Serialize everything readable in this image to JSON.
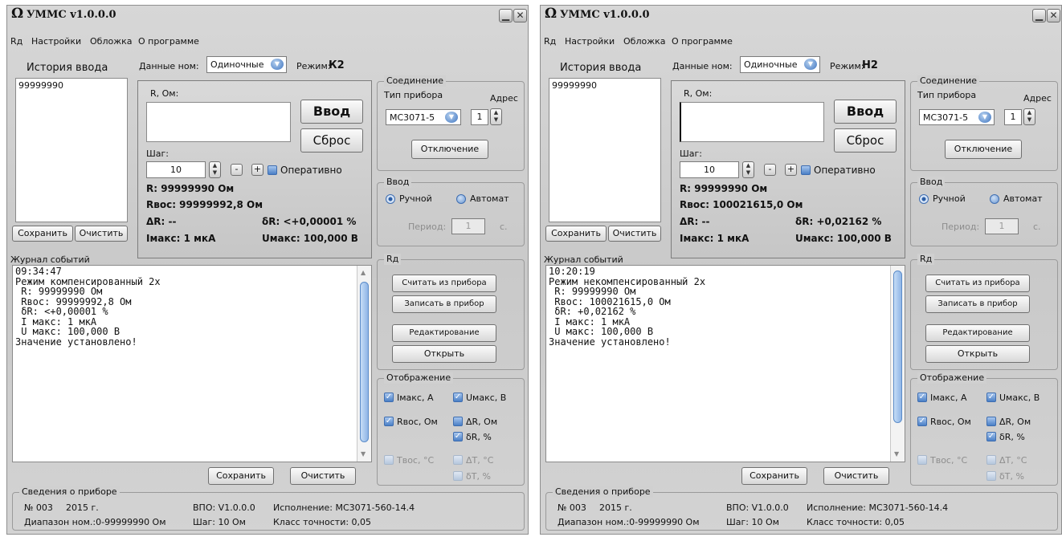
{
  "windows": [
    {
      "title": "УММС v1.0.0.0",
      "menu": [
        "Rд",
        "Настройки",
        "Обложка",
        "О программе"
      ],
      "history_label": "История ввода",
      "history_items": [
        "99999990"
      ],
      "save_label": "Сохранить",
      "clear_label": "Очистить",
      "data_nom_label": "Данные ном:",
      "data_nom_value": "Одиночные",
      "mode_label": "Режим:",
      "mode_value": "К2",
      "r_label": "R, Ом:",
      "r_input": "",
      "enter_label": "Ввод",
      "reset_label": "Сброс",
      "step_label": "Шаг:",
      "step_value": "10",
      "minus": "-",
      "plus": "+",
      "operative_label": "Оперативно",
      "r_line": "R: 99999990 Ом",
      "rvos_line": "Rвос: 99999992,8 Ом",
      "dR_line": "ΔR: --",
      "deltaR_line": "δR: <+0,00001 %",
      "imax_line": "Iмакс: 1 мкА",
      "umax_line": "Uмакс: 100,000 В",
      "connection": {
        "legend": "Соединение",
        "device_type_label": "Тип прибора",
        "address_label": "Адрес",
        "device_value": "МС3071-5",
        "address_value": "1",
        "disconnect_label": "Отключение"
      },
      "input_mode": {
        "legend": "Ввод",
        "manual": "Ручной",
        "auto": "Автомат",
        "period_label": "Период:",
        "period_value": "1",
        "unit": "с."
      },
      "log_label": "Журнал событий",
      "log_lines": [
        "09:34:47",
        "Режим компенсированный 2х",
        " R: 99999990 Ом",
        " Rвос: 99999992,8 Ом",
        " δR: <+0,00001 %",
        " I макс: 1 мкА",
        " U макс: 100,000 В",
        "Значение установлено!"
      ],
      "log_save": "Сохранить",
      "log_clear": "Очистить",
      "rd_group": {
        "legend": "Rд",
        "read": "Считать из прибора",
        "write": "Записать в прибор",
        "edit": "Редактирование",
        "open": "Открыть"
      },
      "display": {
        "legend": "Отображение",
        "imax": "Iмакс, А",
        "umax": "Uмакс, В",
        "rvos": "Rвос, Ом",
        "dR": "ΔR, Ом",
        "deltaR": "δR, %",
        "tvos": "Tвос, °C",
        "dT": "ΔT, °C",
        "deltaT": "δT, %"
      },
      "device_info": {
        "legend": "Сведения о приборе",
        "number": "№ 003",
        "year": "2015 г.",
        "vpo": "ВПО: V1.0.0.0",
        "execution": "Исполнение: МС3071-560-14.4",
        "range": "Диапазон ном.:0-99999990 Ом",
        "step": "Шаг: 10 Ом",
        "accuracy": "Класс точности: 0,05"
      }
    },
    {
      "title": "УММС v1.0.0.0",
      "menu": [
        "Rд",
        "Настройки",
        "Обложка",
        "О программе"
      ],
      "history_label": "История ввода",
      "history_items": [
        "99999990"
      ],
      "save_label": "Сохранить",
      "clear_label": "Очистить",
      "data_nom_label": "Данные ном:",
      "data_nom_value": "Одиночные",
      "mode_label": "Режим:",
      "mode_value": "Н2",
      "r_label": "R, Ом:",
      "r_input": "",
      "enter_label": "Ввод",
      "reset_label": "Сброс",
      "step_label": "Шаг:",
      "step_value": "10",
      "minus": "-",
      "plus": "+",
      "operative_label": "Оперативно",
      "r_line": "R: 99999990 Ом",
      "rvos_line": "Rвос: 100021615,0 Ом",
      "dR_line": "ΔR: --",
      "deltaR_line": "δR: +0,02162 %",
      "imax_line": "Iмакс: 1 мкА",
      "umax_line": "Uмакс: 100,000 В",
      "connection": {
        "legend": "Соединение",
        "device_type_label": "Тип прибора",
        "address_label": "Адрес",
        "device_value": "МС3071-5",
        "address_value": "1",
        "disconnect_label": "Отключение"
      },
      "input_mode": {
        "legend": "Ввод",
        "manual": "Ручной",
        "auto": "Автомат",
        "period_label": "Период:",
        "period_value": "1",
        "unit": "с."
      },
      "log_label": "Журнал событий",
      "log_lines": [
        "10:20:19",
        "Режим некомпенсированный 2х",
        " R: 99999990 Ом",
        " Rвос: 100021615,0 Ом",
        " δR: +0,02162 %",
        " I макс: 1 мкА",
        " U макс: 100,000 В",
        "Значение установлено!"
      ],
      "log_save": "Сохранить",
      "log_clear": "Очистить",
      "rd_group": {
        "legend": "Rд",
        "read": "Считать из прибора",
        "write": "Записать в прибор",
        "edit": "Редактирование",
        "open": "Открыть"
      },
      "display": {
        "legend": "Отображение",
        "imax": "Iмакс, А",
        "umax": "Uмакс, В",
        "rvos": "Rвос, Ом",
        "dR": "ΔR, Ом",
        "deltaR": "δR, %",
        "tvos": "Tвос, °C",
        "dT": "ΔT, °C",
        "deltaT": "δT, %"
      },
      "device_info": {
        "legend": "Сведения о приборе",
        "number": "№ 003",
        "year": "2015 г.",
        "vpo": "ВПО: V1.0.0.0",
        "execution": "Исполнение: МС3071-560-14.4",
        "range": "Диапазон ном.:0-99999990 Ом",
        "step": "Шаг: 10 Ом",
        "accuracy": "Класс точности: 0,05"
      }
    }
  ]
}
